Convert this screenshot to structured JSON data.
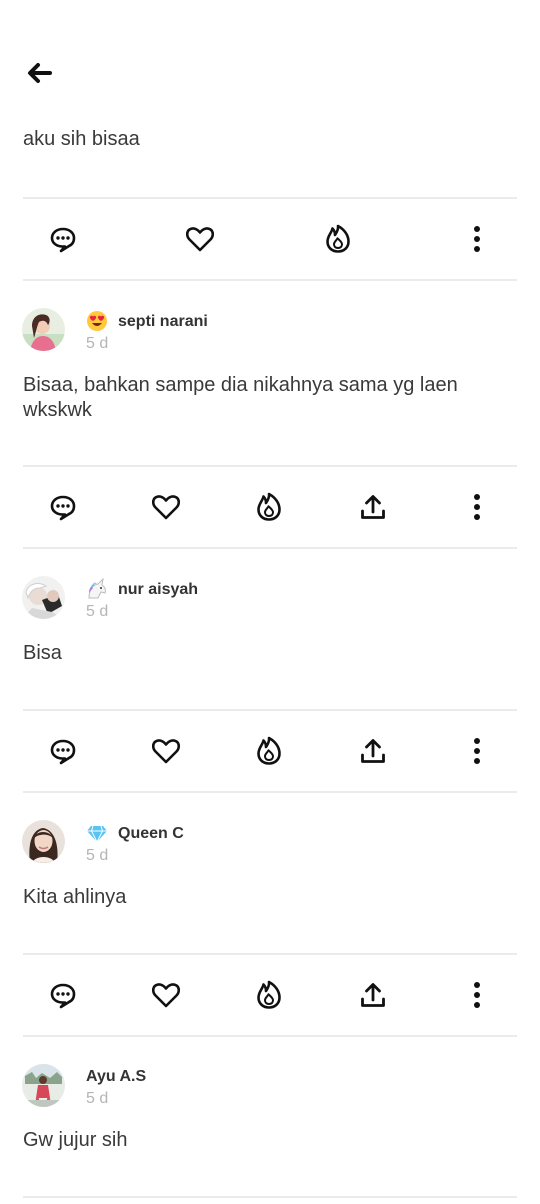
{
  "header": {
    "back_icon": "arrow-left-icon",
    "parent_text": "aku sih bisaa"
  },
  "colors": {
    "icon": "#111111",
    "username": "#333333",
    "timestamp": "#b5b5b5",
    "divider": "#ebebeb",
    "text": "#3a3a3a"
  },
  "parent_actions": [
    "reply-icon",
    "like-icon",
    "fire-icon",
    "more-icon"
  ],
  "comment_actions": [
    "reply-icon",
    "like-icon",
    "fire-icon",
    "share-icon",
    "more-icon"
  ],
  "comments": [
    {
      "username": "septi narani",
      "badge": "heart-eyes-emoji",
      "time": "5 d",
      "text": "Bisaa, bahkan sampe dia nikahnya sama yg laen wkskwk"
    },
    {
      "username": "nur aisyah",
      "badge": "unicorn-emoji",
      "time": "5 d",
      "text": "Bisa"
    },
    {
      "username": "Queen C",
      "badge": "diamond-emoji",
      "time": "5 d",
      "text": "Kita ahlinya"
    },
    {
      "username": "Ayu A.S",
      "badge": "",
      "time": "5 d",
      "text": "Gw jujur sih"
    }
  ]
}
